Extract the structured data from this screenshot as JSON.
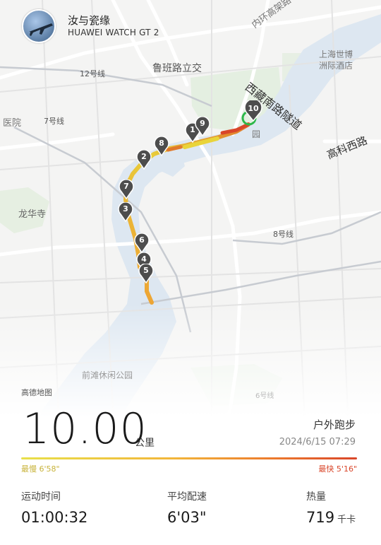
{
  "user": {
    "name": "汝与瓷缘",
    "device": "HUAWEI WATCH GT 2"
  },
  "map": {
    "labels": {
      "metro12": "12号线",
      "metro7": "7号线",
      "metro8": "8号线",
      "metro6": "6号线",
      "hospital": "医院",
      "longhua": "龙华寺",
      "lubanlu": "鲁班路立交",
      "hotel_line1": "上海世博",
      "hotel_line2": "洲际酒店",
      "tunnel": "西藏南路隧道",
      "gaoke": "高科西路",
      "inner_ring": "内环高架路",
      "qiantan": "前滩休闲公园",
      "yuan": "园"
    },
    "markers": [
      "1",
      "2",
      "3",
      "4",
      "5",
      "6",
      "7",
      "8",
      "9",
      "10"
    ],
    "attribution": "高德地图"
  },
  "summary": {
    "distance": "10.00",
    "distance_unit": "公里",
    "activity_type": "户外跑步",
    "datetime": "2024/6/15 07:29",
    "slowest": "最慢 6'58\"",
    "fastest": "最快 5'16\""
  },
  "stats": {
    "duration_label": "运动时间",
    "duration_value": "01:00:32",
    "pace_label": "平均配速",
    "pace_value": "6'03\"",
    "calories_label": "热量",
    "calories_value": "719",
    "calories_unit": "千卡"
  },
  "colors": {
    "river": "#dde7f1",
    "route_slow": "#e8e04a",
    "route_mid": "#f2a93a",
    "route_fast": "#d9462a",
    "marker": "#4d4d4d",
    "end_ring": "#2db84a"
  }
}
